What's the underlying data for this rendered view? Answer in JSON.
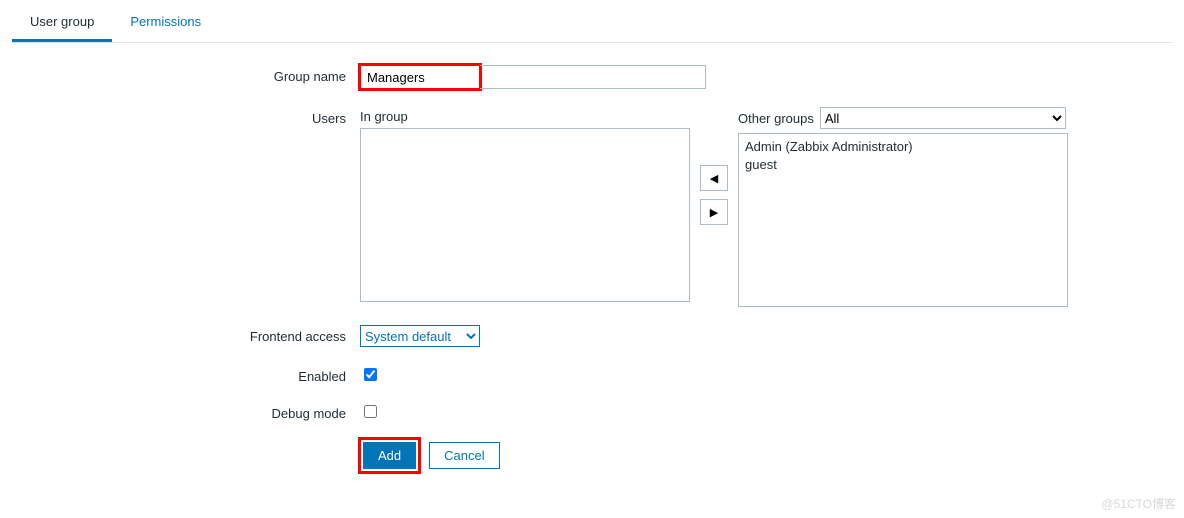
{
  "tabs": {
    "user_group": "User group",
    "permissions": "Permissions"
  },
  "labels": {
    "group_name": "Group name",
    "users": "Users",
    "in_group": "In group",
    "other_groups": "Other groups",
    "frontend_access": "Frontend access",
    "enabled": "Enabled",
    "debug_mode": "Debug mode"
  },
  "form": {
    "group_name": "Managers",
    "other_groups_selected": "All",
    "other_users": [
      "Admin (Zabbix Administrator)",
      "guest"
    ],
    "frontend_access": "System default",
    "enabled": true,
    "debug_mode": false
  },
  "buttons": {
    "add": "Add",
    "cancel": "Cancel",
    "left": "◀",
    "right": "▶"
  },
  "watermark": "@51CTO博客"
}
